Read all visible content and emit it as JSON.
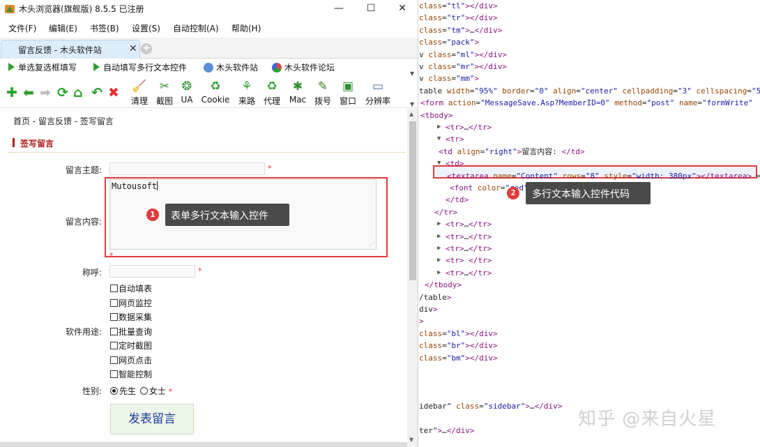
{
  "window": {
    "title": "木头浏览器(旗舰版) 8.5.5  已注册",
    "min_glyph": "—",
    "max_glyph": "☐",
    "close_glyph": "✕"
  },
  "menu": [
    "文件(F)",
    "编辑(E)",
    "书签(B)",
    "设置(S)",
    "自动控制(A)",
    "帮助(H)"
  ],
  "tab": {
    "label": "留言反馈 - 木头软件站",
    "close_glyph": "✕",
    "new_glyph": "+"
  },
  "quickbar": [
    "单选复选框填写",
    "自动填写多行文本控件",
    "木头软件站",
    "木头软件论坛"
  ],
  "nav_icons": [
    "plus-icon",
    "back-icon",
    "forward-icon",
    "refresh-icon",
    "home-icon",
    "undo-icon",
    "stop-icon"
  ],
  "tools": [
    {
      "label": "清理",
      "icon": "broom-icon",
      "glyph": "🧹",
      "color": "#c07a1c"
    },
    {
      "label": "截图",
      "icon": "scissors-icon",
      "glyph": "✂",
      "color": "#2c8f2c"
    },
    {
      "label": "UA",
      "icon": "ua-icon",
      "glyph": "❂",
      "color": "#2c8f2c"
    },
    {
      "label": "Cookie",
      "icon": "recycle-icon",
      "glyph": "♻",
      "color": "#2ca02c"
    },
    {
      "label": "来路",
      "icon": "route-icon",
      "glyph": "⚘",
      "color": "#2ca02c"
    },
    {
      "label": "代理",
      "icon": "proxy-icon",
      "glyph": "♻",
      "color": "#3aa03a"
    },
    {
      "label": "Mac",
      "icon": "mac-icon",
      "glyph": "✱",
      "color": "#2c8f2c"
    },
    {
      "label": "拨号",
      "icon": "dial-icon",
      "glyph": "✎",
      "color": "#3a7a2a"
    },
    {
      "label": "窗口",
      "icon": "window-icon",
      "glyph": "▣",
      "color": "#2c8f2c"
    },
    {
      "label": "分辨率",
      "icon": "monitor-icon",
      "glyph": "▭",
      "color": "#3a6a9a"
    }
  ],
  "page": {
    "breadcrumb": "首页 - 留言反馈 - 签写留言",
    "section_title": "签写留言",
    "labels": {
      "subject": "留言主题:",
      "content": "留言内容:",
      "nickname": "称呼:",
      "usage": "软件用途:",
      "gender": "性别:"
    },
    "required_mark": "*",
    "content_value": "Mutousoft",
    "usage_options": [
      "自动填表",
      "网页监控",
      "数据采集",
      "批量查询",
      "定时截图",
      "网页点击",
      "智能控制"
    ],
    "gender_options": [
      {
        "label": "先生",
        "checked": true
      },
      {
        "label": "女士",
        "checked": false
      }
    ],
    "submit_label": "发表留言"
  },
  "callouts": [
    {
      "num": "1",
      "text": "表单多行文本输入控件"
    },
    {
      "num": "2",
      "text": "多行文本输入控件代码"
    }
  ],
  "devtools": {
    "lines": [
      {
        "text": "class=\"tl\"></div>",
        "tri": ""
      },
      {
        "text": "class=\"tr\"></div>",
        "tri": ""
      },
      {
        "text": "class=\"tm\">…</div>",
        "tri": ""
      },
      {
        "text": "class=\"pack\">",
        "tri": ""
      },
      {
        "text": "v class=\"ml\"></div>",
        "tri": ""
      },
      {
        "text": "v class=\"mr\"></div>",
        "tri": ""
      },
      {
        "text": "v class=\"mm\">",
        "tri": ""
      },
      {
        "text": "table width=\"95%\" border=\"0\" align=\"center\" cellpadding=\"3\" cellspacing=\"5\"",
        "tri": ""
      },
      {
        "text": "<form action=\"MessageSave.Asp?MemberID=0\" method=\"post\" name=\"formWrite\"",
        "tri": ""
      },
      {
        "text": "<tbody>",
        "tri": ""
      },
      {
        "text": "<tr>…</tr>",
        "tri": "▶"
      },
      {
        "text": "<tr>",
        "tri": "▼"
      },
      {
        "text": "<td align=\"right\">留言内容: </td>",
        "tri": ""
      },
      {
        "text": "<td>",
        "tri": "▼"
      },
      {
        "text": "<textarea name=\"Content\" rows=\"8\" style=\"width: 380px\"></textarea> ==",
        "tri": ""
      },
      {
        "text": "<font color=\"red\">*</font>",
        "tri": ""
      },
      {
        "text": "</td>",
        "tri": ""
      },
      {
        "text": "</tr>",
        "tri": ""
      },
      {
        "text": "<tr>…</tr>",
        "tri": "▶"
      },
      {
        "text": "<tr>…</tr>",
        "tri": "▶"
      },
      {
        "text": "<tr>…</tr>",
        "tri": "▶"
      },
      {
        "text": "<tr> </tr>",
        "tri": "▶"
      },
      {
        "text": "<tr>…</tr>",
        "tri": "▶"
      },
      {
        "text": "</tbody>",
        "tri": ""
      },
      {
        "text": "/table>",
        "tri": ""
      },
      {
        "text": "div>",
        "tri": ""
      },
      {
        "text": ">",
        "tri": ""
      },
      {
        "text": "class=\"bl\"></div>",
        "tri": ""
      },
      {
        "text": "class=\"br\"></div>",
        "tri": ""
      },
      {
        "text": "class=\"bm\"></div>",
        "tri": ""
      },
      {
        "text": "",
        "tri": ""
      },
      {
        "text": "",
        "tri": ""
      },
      {
        "text": "",
        "tri": ""
      },
      {
        "text": "idebar\" class=\"sidebar\">…</div>",
        "tri": ""
      },
      {
        "text": "",
        "tri": ""
      },
      {
        "text": "ter\">…</div>",
        "tri": ""
      }
    ],
    "watermark": "知乎 @来自火星"
  },
  "colors": {
    "accent_red": "#e03a3a",
    "section_red": "#b01e1e",
    "callout_bg": "#4a4a4a",
    "tag": "#881280",
    "attr": "#994500",
    "value": "#1a1aa6"
  }
}
